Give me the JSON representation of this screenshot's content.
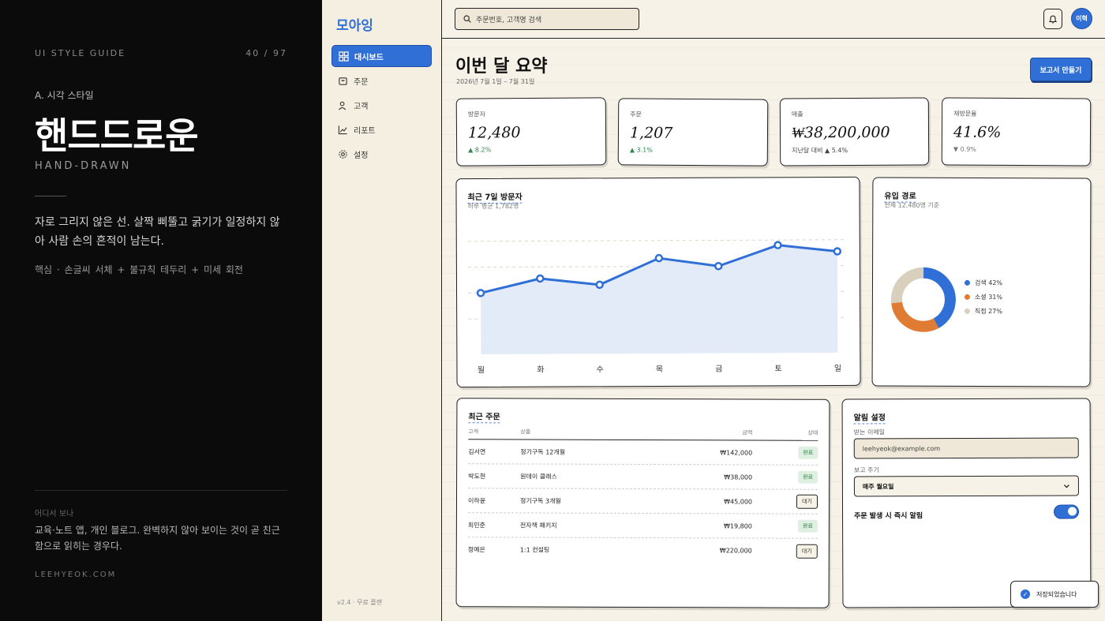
{
  "guide": {
    "label": "UI STYLE GUIDE",
    "page": "40 / 97",
    "section": "A. 시각 스타일",
    "title": "핸드드로운",
    "subtitle": "HAND-DRAWN",
    "description": "자로 그리지 않은 선. 살짝 삐뚤고 굵기가 일정하지 않아 사람 손의 흔적이 남는다.",
    "key": "핵심 · 손글씨 서체 + 불규칙 테두리 + 미세 회전",
    "where_label": "어디서 보나",
    "where": "교육·노트 앱, 개인 블로그. 완벽하지 않아 보이는 것이 곧 친근함으로 읽히는 경우다.",
    "site": "LEEHYEOK.COM"
  },
  "app": {
    "logo": "모아잉",
    "nav": [
      {
        "label": "대시보드",
        "icon": "grid-icon"
      },
      {
        "label": "주문",
        "icon": "bag-icon"
      },
      {
        "label": "고객",
        "icon": "user-icon"
      },
      {
        "label": "리포트",
        "icon": "chart-icon"
      },
      {
        "label": "설정",
        "icon": "gear-icon"
      }
    ],
    "version": "v2.4 · 무료 플랜",
    "search_placeholder": "주문번호, 고객명 검색",
    "avatar": "이혁",
    "page_title": "이번 달 요약",
    "date_range": "2026년 7월 1일 – 7월 31일",
    "report_button": "보고서 만들기"
  },
  "kpis": [
    {
      "label": "방문자",
      "value": "12,480",
      "delta": "▲ 8.2%",
      "dir": "up"
    },
    {
      "label": "주문",
      "value": "1,207",
      "delta": "▲ 3.1%",
      "dir": "up"
    },
    {
      "label": "매출",
      "value": "₩38,200,000",
      "delta": "지난달 대비 ▲ 5.4%",
      "dir": "up"
    },
    {
      "label": "재방문율",
      "value": "41.6%",
      "delta": "▼ 0.9%",
      "dir": "down"
    }
  ],
  "visitors": {
    "title": "최근 7일 방문자",
    "subtitle": "하루 평균 1,782명"
  },
  "chart_data": [
    {
      "type": "area",
      "title": "최근 7일 방문자",
      "categories": [
        "월",
        "화",
        "수",
        "목",
        "금",
        "토",
        "일"
      ],
      "values": [
        1420,
        1750,
        1600,
        2210,
        2020,
        2500,
        2350
      ],
      "ylim": [
        0,
        3000
      ],
      "grid": true,
      "color": "#2f6fd6"
    },
    {
      "type": "pie",
      "title": "유입 경로",
      "categories": [
        "검색",
        "소셜",
        "직접"
      ],
      "values": [
        42,
        31,
        27
      ],
      "colors": [
        "#2f6fd6",
        "#e07b33",
        "#d8cfbd"
      ]
    }
  ],
  "sources": {
    "title": "유입 경로",
    "subtitle": "전체 12,480명 기준",
    "legend": [
      "검색 42%",
      "소셜 31%",
      "직접 27%"
    ],
    "colors": [
      "#2f6fd6",
      "#e07b33",
      "#d8cfbd"
    ]
  },
  "orders": {
    "title": "최근 주문",
    "headers": [
      "고객",
      "상품",
      "금액",
      "상태"
    ],
    "rows": [
      {
        "customer": "김서연",
        "product": "정기구독 12개월",
        "amount": "₩142,000",
        "status": "완료",
        "kind": "done"
      },
      {
        "customer": "박도현",
        "product": "원데이 클래스",
        "amount": "₩38,000",
        "status": "완료",
        "kind": "done"
      },
      {
        "customer": "이하윤",
        "product": "정기구독 3개월",
        "amount": "₩45,000",
        "status": "대기",
        "kind": "wait"
      },
      {
        "customer": "최민준",
        "product": "전자책 패키지",
        "amount": "₩19,800",
        "status": "완료",
        "kind": "done"
      },
      {
        "customer": "정예은",
        "product": "1:1 컨설팅",
        "amount": "₩220,000",
        "status": "대기",
        "kind": "wait"
      }
    ]
  },
  "alerts": {
    "title": "알림 설정",
    "email_label": "받는 이메일",
    "email_value": "leehyeok@example.com",
    "period_label": "보고 주기",
    "period_value": "매주 월요일",
    "toggle_label": "주문 발생 시 즉시 알림",
    "toggle_on": true
  },
  "toast": "저장되었습니다"
}
